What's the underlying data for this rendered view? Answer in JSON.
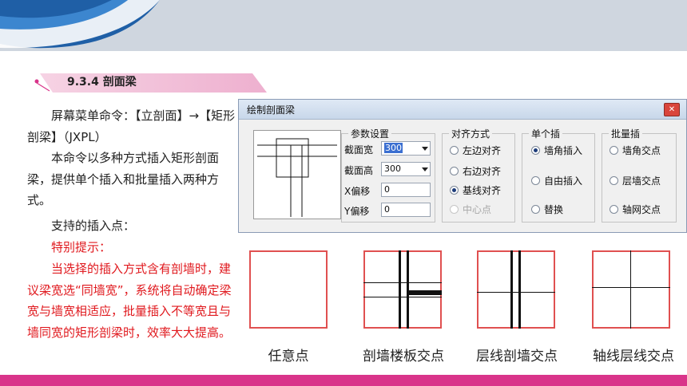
{
  "section": {
    "title": "9.3.4 剖面梁"
  },
  "paragraphs": [
    {
      "text": "屏幕菜单命令：【立剖面】→【矩形剖梁】（JXPL）",
      "red": false
    },
    {
      "text": "本命令以多种方式插入矩形剖面梁，提供单个插入和批量插入两种方式。",
      "red": false
    },
    {
      "text": "支持的插入点：",
      "red": false
    },
    {
      "text": "特别提示：",
      "red": true
    },
    {
      "text": "当选择的插入方式含有剖墙时，建议梁宽选“同墙宽”，系统将自动确定梁宽与墙宽相适应，批量插入不等宽且与墙同宽的矩形剖梁时，效率大大提高。",
      "red": true
    }
  ],
  "dialog": {
    "title": "绘制剖面梁",
    "close_icon": "close-icon",
    "params": {
      "label": "参数设置",
      "width_label": "截面宽",
      "width_value": "300",
      "height_label": "截面高",
      "height_value": "300",
      "xoffset_label": "X偏移",
      "xoffset_value": "0",
      "yoffset_label": "Y偏移",
      "yoffset_value": "0"
    },
    "align": {
      "label": "对齐方式",
      "options": [
        {
          "label": "左边对齐",
          "selected": false,
          "disabled": false
        },
        {
          "label": "右边对齐",
          "selected": false,
          "disabled": false
        },
        {
          "label": "基线对齐",
          "selected": true,
          "disabled": false
        },
        {
          "label": "中心点",
          "selected": false,
          "disabled": true
        }
      ]
    },
    "single": {
      "label": "单个插",
      "options": [
        {
          "label": "墙角插入",
          "selected": true
        },
        {
          "label": "自由插入",
          "selected": false
        },
        {
          "label": "替换",
          "selected": false
        }
      ]
    },
    "batch": {
      "label": "批量插",
      "options": [
        {
          "label": "墙角交点",
          "selected": false
        },
        {
          "label": "层墙交点",
          "selected": false
        },
        {
          "label": "轴网交点",
          "selected": false
        }
      ]
    }
  },
  "insert_points": [
    "任意点",
    "剖墙楼板交点",
    "层线剖墙交点",
    "轴线层线交点"
  ],
  "colors": {
    "accent_red": "#e0191e",
    "bottom_bar": "#d9348a",
    "section_tab": "#f4c6dc"
  }
}
